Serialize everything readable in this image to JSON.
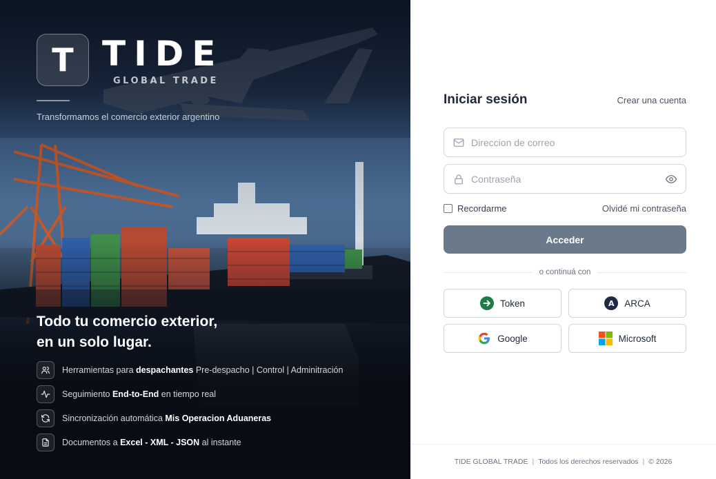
{
  "brand": {
    "logo_letter": "T",
    "name": "TIDE",
    "subtitle": "GLOBAL TRADE",
    "tagline": "Transformamos el comercio exterior argentino"
  },
  "hero": {
    "headline_line1": "Todo tu comercio exterior,",
    "headline_line2": "en un solo lugar.",
    "features": [
      {
        "icon": "users-icon",
        "pre": "Herramientas para ",
        "bold": "despachantes",
        "post": " Pre-despacho | Control | Adminitración"
      },
      {
        "icon": "activity-icon",
        "pre": "Seguimiento ",
        "bold": "End-to-End",
        "post": " en tiempo real"
      },
      {
        "icon": "refresh-icon",
        "pre": "Sincronización automática ",
        "bold": "Mis Operacion Aduaneras",
        "post": ""
      },
      {
        "icon": "document-icon",
        "pre": "Documentos a ",
        "bold": "Excel - XML - JSON",
        "post": " al instante"
      }
    ]
  },
  "login": {
    "title": "Iniciar sesión",
    "create_account": "Crear una cuenta",
    "email_placeholder": "Direccion de correo",
    "password_placeholder": "Contraseña",
    "remember_label": "Recordarme",
    "forgot_label": "Olvidé mi contraseña",
    "submit_label": "Acceder",
    "divider_label": "o continuá con",
    "providers": {
      "token": "Token",
      "arca": "ARCA",
      "arca_letter": "A",
      "google": "Google",
      "microsoft": "Microsoft"
    }
  },
  "footer": {
    "company": "TIDE GLOBAL TRADE",
    "rights": "Todos los derechos reservados",
    "copyright": "© 2026"
  },
  "colors": {
    "submit_bg": "#6b7a8a",
    "token_green": "#1e7a46",
    "arca_navy": "#1f2a44",
    "hero_dark": "#0e141f"
  }
}
